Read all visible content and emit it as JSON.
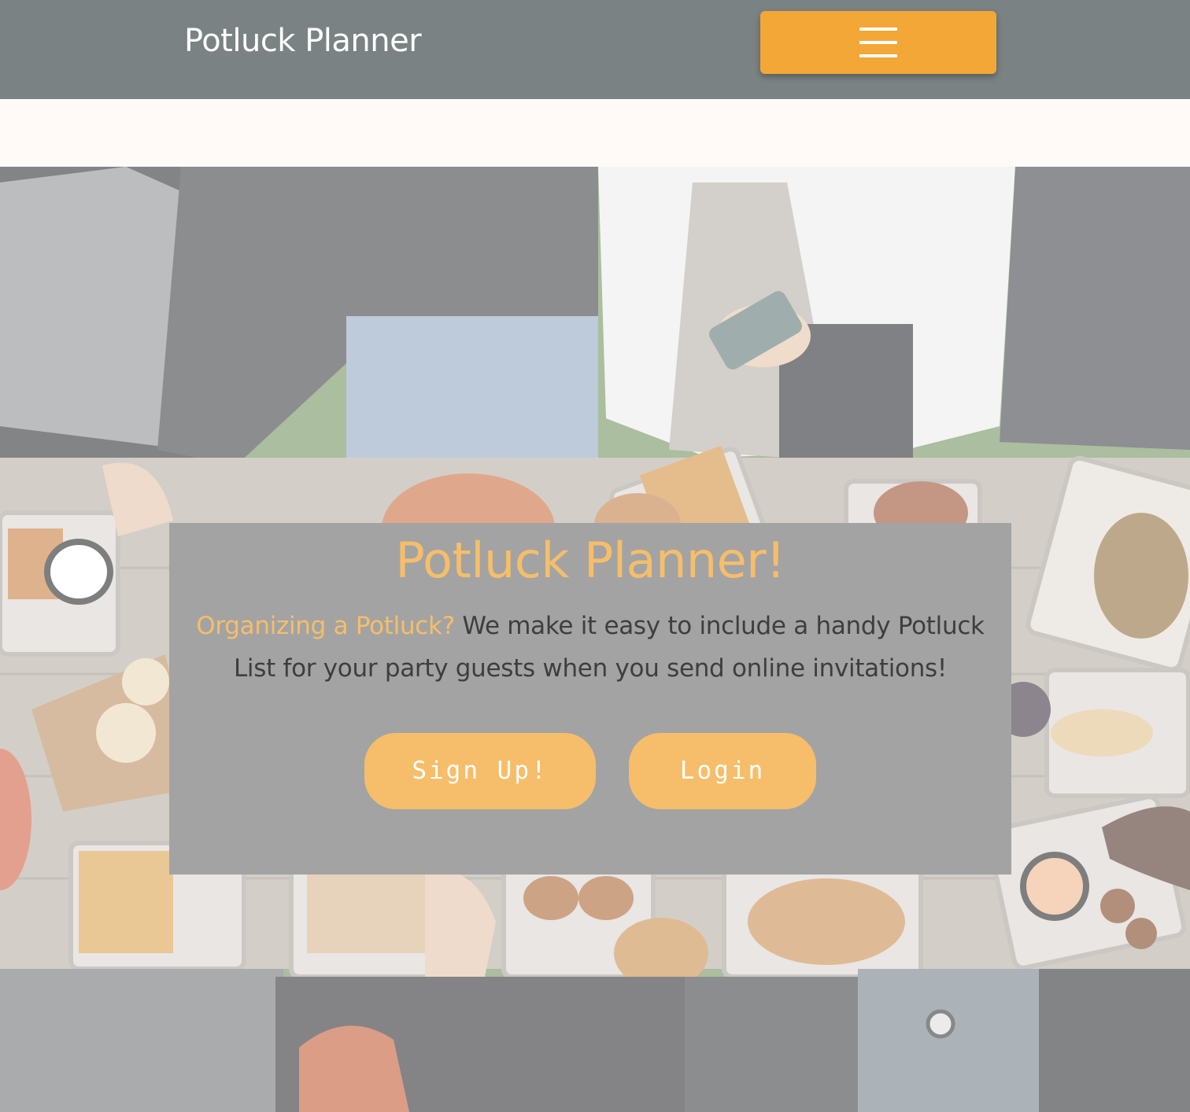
{
  "header": {
    "brand": "Potluck Planner",
    "menu_icon": "hamburger-menu-icon"
  },
  "hero": {
    "image": "overhead photo of people sharing a picnic table full of food trays",
    "title": "Potluck Planner!",
    "tagline_accent": "Organizing a Potluck?",
    "tagline_body": " We make it easy to include a handy Potluck List for your party guests when you send online invitations!",
    "buttons": {
      "signup_label": "Sign Up!",
      "login_label": "Login"
    }
  },
  "colors": {
    "navbar": "#7a8284",
    "accent": "#f2a736",
    "button": "#f6be6a",
    "card": "#a3a3a3",
    "page_background": "#fffaf8"
  }
}
